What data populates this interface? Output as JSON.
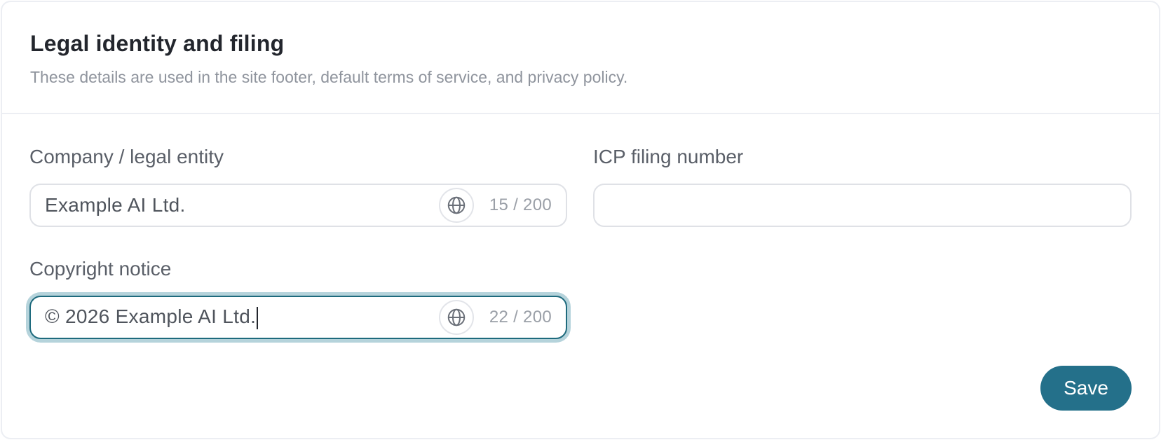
{
  "section": {
    "title": "Legal identity and filing",
    "subtitle": "These details are used in the site footer, default terms of service, and privacy policy."
  },
  "fields": {
    "company": {
      "label": "Company / legal entity",
      "value": "Example AI Ltd.",
      "counter": "15 / 200",
      "icon": "globe-icon"
    },
    "icp": {
      "label": "ICP filing number",
      "value": ""
    },
    "copyright": {
      "label": "Copyright notice",
      "value": "© 2026 Example AI Ltd.",
      "counter": "22 / 200",
      "icon": "globe-icon",
      "focused": true
    }
  },
  "actions": {
    "save_label": "Save"
  },
  "colors": {
    "accent": "#24708a",
    "focus_ring": "#b5d3db",
    "border": "#dfe1e6"
  }
}
